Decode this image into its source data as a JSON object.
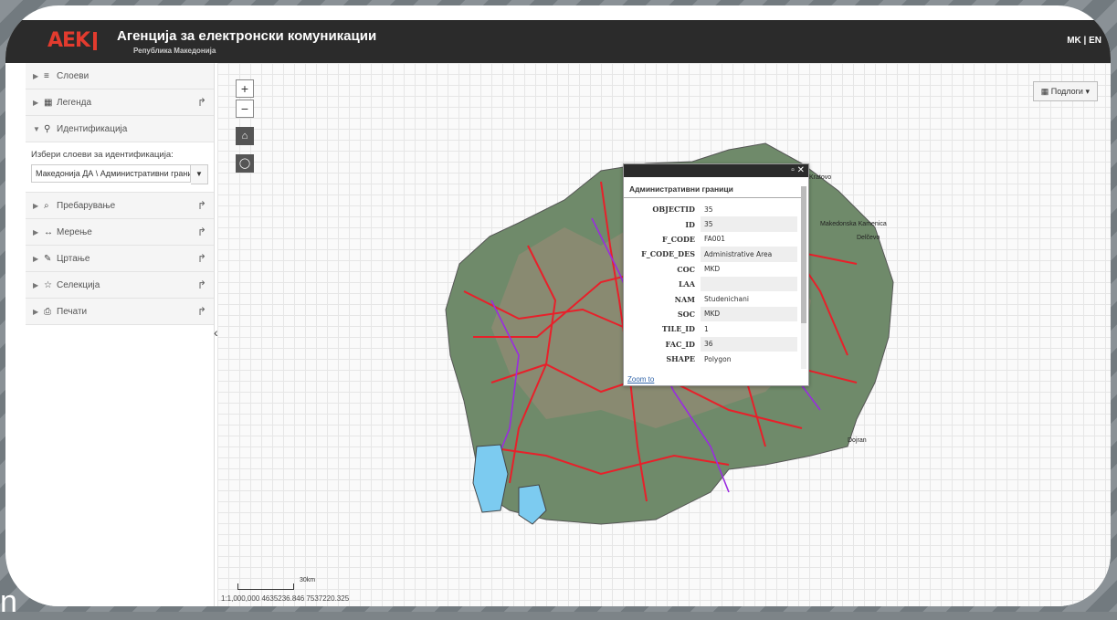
{
  "header": {
    "logo_text": "AEK",
    "title": "Агенција за електронски комуникации",
    "subtitle": "Република Македонија",
    "language": "MK | EN"
  },
  "sidebar": {
    "panels": [
      {
        "label": "Слоеви",
        "icon": "list-icon",
        "expanded": false,
        "share": false
      },
      {
        "label": "Легенда",
        "icon": "grid-icon",
        "expanded": false,
        "share": true
      },
      {
        "label": "Идентификација",
        "icon": "pin-icon",
        "expanded": true,
        "share": false
      },
      {
        "label": "Пребарување",
        "icon": "search-icon",
        "expanded": false,
        "share": true
      },
      {
        "label": "Мерење",
        "icon": "ruler-icon",
        "expanded": false,
        "share": true
      },
      {
        "label": "Цртање",
        "icon": "pencil-icon",
        "expanded": false,
        "share": true
      },
      {
        "label": "Селекција",
        "icon": "star-icon",
        "expanded": false,
        "share": true
      },
      {
        "label": "Печати",
        "icon": "print-icon",
        "expanded": false,
        "share": true
      }
    ],
    "identification": {
      "hint": "Избери слоеви за идентификација:",
      "selected_layer": "Македонија ДА \\ Административни граници"
    }
  },
  "map": {
    "basemaps_label": "Подлоги",
    "zoom_in": "+",
    "zoom_out": "−",
    "scale_label": "30km",
    "coords": "1:1,000,000  4635236.846  7537220.325",
    "places": [
      "Kratovo",
      "Makedonska Kamenica",
      "Delčevo",
      "Dojran"
    ]
  },
  "popup": {
    "title": "Административни граници",
    "attributes": [
      {
        "key": "OBJECTID",
        "value": "35"
      },
      {
        "key": "ID",
        "value": "35"
      },
      {
        "key": "F_CODE",
        "value": "FA001"
      },
      {
        "key": "F_CODE_DES",
        "value": "Administrative Area"
      },
      {
        "key": "COC",
        "value": "MKD"
      },
      {
        "key": "LAA",
        "value": ""
      },
      {
        "key": "NAM",
        "value": "Studenichani"
      },
      {
        "key": "SOC",
        "value": "MKD"
      },
      {
        "key": "TILE_ID",
        "value": "1"
      },
      {
        "key": "FAC_ID",
        "value": "36"
      },
      {
        "key": "SHAPE",
        "value": "Polygon"
      }
    ],
    "zoom_to": "Zoom to"
  },
  "overlay_text": "n",
  "colors": {
    "header_bg": "#2b2b2b",
    "logo_red": "#e23b2e",
    "roads": "#e8202a",
    "rivers": "#9a2be0",
    "lakes": "#7ccbf0"
  }
}
